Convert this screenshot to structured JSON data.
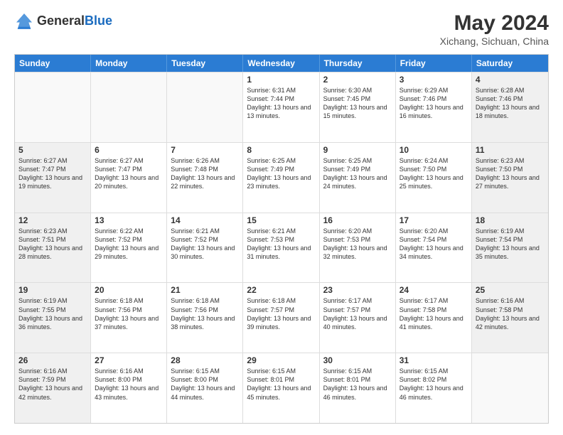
{
  "header": {
    "logo_general": "General",
    "logo_blue": "Blue",
    "month_year": "May 2024",
    "location": "Xichang, Sichuan, China"
  },
  "days_of_week": [
    "Sunday",
    "Monday",
    "Tuesday",
    "Wednesday",
    "Thursday",
    "Friday",
    "Saturday"
  ],
  "weeks": [
    [
      {
        "day": "",
        "empty": true
      },
      {
        "day": "",
        "empty": true
      },
      {
        "day": "",
        "empty": true
      },
      {
        "day": "1",
        "sunrise": "6:31 AM",
        "sunset": "7:44 PM",
        "daylight": "13 hours and 13 minutes."
      },
      {
        "day": "2",
        "sunrise": "6:30 AM",
        "sunset": "7:45 PM",
        "daylight": "13 hours and 15 minutes."
      },
      {
        "day": "3",
        "sunrise": "6:29 AM",
        "sunset": "7:46 PM",
        "daylight": "13 hours and 16 minutes."
      },
      {
        "day": "4",
        "sunrise": "6:28 AM",
        "sunset": "7:46 PM",
        "daylight": "13 hours and 18 minutes."
      }
    ],
    [
      {
        "day": "5",
        "sunrise": "6:27 AM",
        "sunset": "7:47 PM",
        "daylight": "13 hours and 19 minutes."
      },
      {
        "day": "6",
        "sunrise": "6:27 AM",
        "sunset": "7:47 PM",
        "daylight": "13 hours and 20 minutes."
      },
      {
        "day": "7",
        "sunrise": "6:26 AM",
        "sunset": "7:48 PM",
        "daylight": "13 hours and 22 minutes."
      },
      {
        "day": "8",
        "sunrise": "6:25 AM",
        "sunset": "7:49 PM",
        "daylight": "13 hours and 23 minutes."
      },
      {
        "day": "9",
        "sunrise": "6:25 AM",
        "sunset": "7:49 PM",
        "daylight": "13 hours and 24 minutes."
      },
      {
        "day": "10",
        "sunrise": "6:24 AM",
        "sunset": "7:50 PM",
        "daylight": "13 hours and 25 minutes."
      },
      {
        "day": "11",
        "sunrise": "6:23 AM",
        "sunset": "7:50 PM",
        "daylight": "13 hours and 27 minutes."
      }
    ],
    [
      {
        "day": "12",
        "sunrise": "6:23 AM",
        "sunset": "7:51 PM",
        "daylight": "13 hours and 28 minutes."
      },
      {
        "day": "13",
        "sunrise": "6:22 AM",
        "sunset": "7:52 PM",
        "daylight": "13 hours and 29 minutes."
      },
      {
        "day": "14",
        "sunrise": "6:21 AM",
        "sunset": "7:52 PM",
        "daylight": "13 hours and 30 minutes."
      },
      {
        "day": "15",
        "sunrise": "6:21 AM",
        "sunset": "7:53 PM",
        "daylight": "13 hours and 31 minutes."
      },
      {
        "day": "16",
        "sunrise": "6:20 AM",
        "sunset": "7:53 PM",
        "daylight": "13 hours and 32 minutes."
      },
      {
        "day": "17",
        "sunrise": "6:20 AM",
        "sunset": "7:54 PM",
        "daylight": "13 hours and 34 minutes."
      },
      {
        "day": "18",
        "sunrise": "6:19 AM",
        "sunset": "7:54 PM",
        "daylight": "13 hours and 35 minutes."
      }
    ],
    [
      {
        "day": "19",
        "sunrise": "6:19 AM",
        "sunset": "7:55 PM",
        "daylight": "13 hours and 36 minutes."
      },
      {
        "day": "20",
        "sunrise": "6:18 AM",
        "sunset": "7:56 PM",
        "daylight": "13 hours and 37 minutes."
      },
      {
        "day": "21",
        "sunrise": "6:18 AM",
        "sunset": "7:56 PM",
        "daylight": "13 hours and 38 minutes."
      },
      {
        "day": "22",
        "sunrise": "6:18 AM",
        "sunset": "7:57 PM",
        "daylight": "13 hours and 39 minutes."
      },
      {
        "day": "23",
        "sunrise": "6:17 AM",
        "sunset": "7:57 PM",
        "daylight": "13 hours and 40 minutes."
      },
      {
        "day": "24",
        "sunrise": "6:17 AM",
        "sunset": "7:58 PM",
        "daylight": "13 hours and 41 minutes."
      },
      {
        "day": "25",
        "sunrise": "6:16 AM",
        "sunset": "7:58 PM",
        "daylight": "13 hours and 42 minutes."
      }
    ],
    [
      {
        "day": "26",
        "sunrise": "6:16 AM",
        "sunset": "7:59 PM",
        "daylight": "13 hours and 42 minutes."
      },
      {
        "day": "27",
        "sunrise": "6:16 AM",
        "sunset": "8:00 PM",
        "daylight": "13 hours and 43 minutes."
      },
      {
        "day": "28",
        "sunrise": "6:15 AM",
        "sunset": "8:00 PM",
        "daylight": "13 hours and 44 minutes."
      },
      {
        "day": "29",
        "sunrise": "6:15 AM",
        "sunset": "8:01 PM",
        "daylight": "13 hours and 45 minutes."
      },
      {
        "day": "30",
        "sunrise": "6:15 AM",
        "sunset": "8:01 PM",
        "daylight": "13 hours and 46 minutes."
      },
      {
        "day": "31",
        "sunrise": "6:15 AM",
        "sunset": "8:02 PM",
        "daylight": "13 hours and 46 minutes."
      },
      {
        "day": "",
        "empty": true
      }
    ]
  ]
}
